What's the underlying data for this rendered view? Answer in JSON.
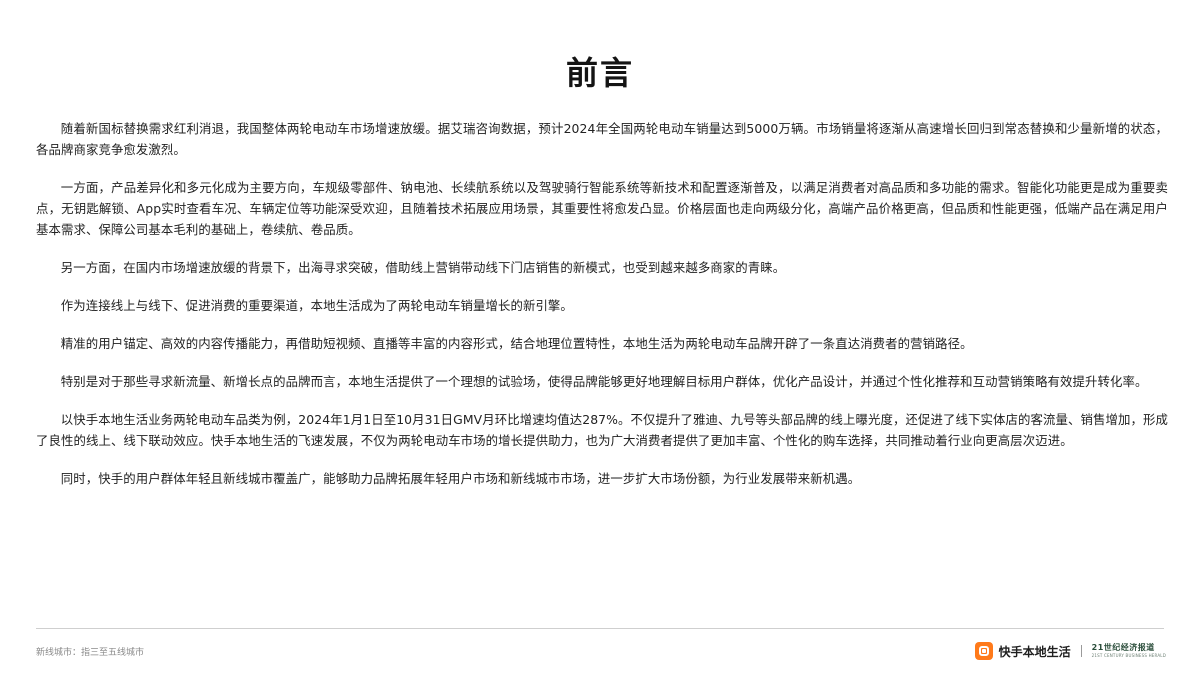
{
  "title": "前言",
  "paragraphs": [
    "随着新国标替换需求红利消退，我国整体两轮电动车市场增速放缓。据艾瑞咨询数据，预计2024年全国两轮电动车销量达到5000万辆。市场销量将逐渐从高速增长回归到常态替换和少量新增的状态，各品牌商家竞争愈发激烈。",
    "一方面，产品差异化和多元化成为主要方向，车规级零部件、钠电池、长续航系统以及驾驶骑行智能系统等新技术和配置逐渐普及，以满足消费者对高品质和多功能的需求。智能化功能更是成为重要卖点，无钥匙解锁、App实时查看车况、车辆定位等功能深受欢迎，且随着技术拓展应用场景，其重要性将愈发凸显。价格层面也走向两级分化，高端产品价格更高，但品质和性能更强，低端产品在满足用户基本需求、保障公司基本毛利的基础上，卷续航、卷品质。",
    "另一方面，在国内市场增速放缓的背景下，出海寻求突破，借助线上营销带动线下门店销售的新模式，也受到越来越多商家的青睐。",
    "作为连接线上与线下、促进消费的重要渠道，本地生活成为了两轮电动车销量增长的新引擎。",
    "精准的用户锚定、高效的内容传播能力，再借助短视频、直播等丰富的内容形式，结合地理位置特性，本地生活为两轮电动车品牌开辟了一条直达消费者的营销路径。",
    "特别是对于那些寻求新流量、新增长点的品牌而言，本地生活提供了一个理想的试验场，使得品牌能够更好地理解目标用户群体，优化产品设计，并通过个性化推荐和互动营销策略有效提升转化率。",
    "以快手本地生活业务两轮电动车品类为例，2024年1月1日至10月31日GMV月环比增速均值达287%。不仅提升了雅迪、九号等头部品牌的线上曝光度，还促进了线下实体店的客流量、销售增加，形成了良性的线上、线下联动效应。快手本地生活的飞速发展，不仅为两轮电动车市场的增长提供助力，也为广大消费者提供了更加丰富、个性化的购车选择，共同推动着行业向更高层次迈进。",
    "同时，快手的用户群体年轻且新线城市覆盖广，能够助力品牌拓展年轻用户市场和新线城市市场，进一步扩大市场份额，为行业发展带来新机遇。"
  ],
  "footnote": "新线城市：指三至五线城市",
  "brand": {
    "logo_icon": "kuaishou-local-logo",
    "name": "快手本地生活",
    "accent": "#ff7a1a",
    "partner_name": "21世纪经济报道",
    "partner_sub": "21ST CENTURY BUSINESS HERALD"
  }
}
